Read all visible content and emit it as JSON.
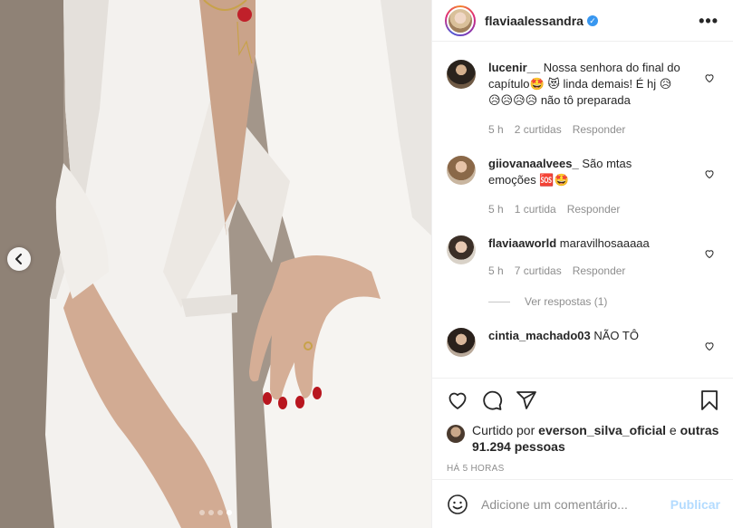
{
  "post": {
    "username": "flaviaalessandra",
    "verified_icon": "verified-badge-icon",
    "more_label": "•••",
    "carousel": {
      "dots": 4,
      "active": 4
    }
  },
  "comments": [
    {
      "username": "lucenir__",
      "text": "Nossa senhora do final do capítulo🤩 😻 linda demais! É hj 😥😥😥😥😥 não tô preparada",
      "time": "5 h",
      "likes": "2 curtidas",
      "reply": "Responder"
    },
    {
      "username": "giiovanaalvees_",
      "text": "São mtas emoções 🆘🤩",
      "time": "5 h",
      "likes": "1 curtida",
      "reply": "Responder"
    },
    {
      "username": "flaviaaworld",
      "text": "maravilhosaaaaa",
      "time": "5 h",
      "likes": "7 curtidas",
      "reply": "Responder",
      "view_replies": "Ver respostas (1)"
    },
    {
      "username": "cintia_machado03",
      "text": "NÃO TÔ"
    }
  ],
  "liked_by": {
    "prefix": "Curtido por",
    "user": "everson_silva_oficial",
    "middle": "e",
    "others": "outras 91.294 pessoas"
  },
  "timestamp": "HÁ 5 HORAS",
  "add_comment": {
    "placeholder": "Adicione um comentário...",
    "publish": "Publicar"
  },
  "colors": {
    "link_blue": "#3897f0",
    "publish_disabled": "#b3dbff",
    "muted": "#8e8e8e"
  }
}
